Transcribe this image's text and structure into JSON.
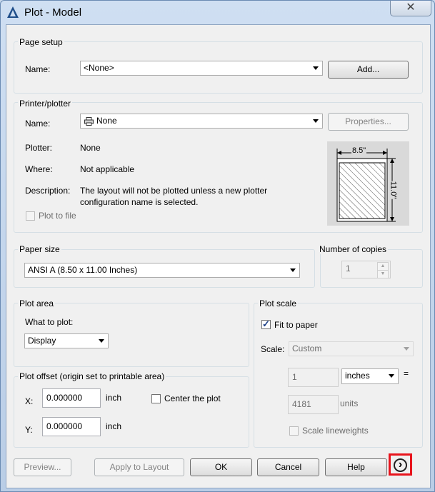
{
  "window": {
    "title": "Plot - Model",
    "close_glyph": "✕"
  },
  "page_setup": {
    "title": "Page setup",
    "name_label": "Name:",
    "name_value": "<None>",
    "add_button": "Add..."
  },
  "printer": {
    "title": "Printer/plotter",
    "name_label": "Name:",
    "name_value": "None",
    "properties_button": "Properties...",
    "plotter_label": "Plotter:",
    "plotter_value": "None",
    "where_label": "Where:",
    "where_value": "Not applicable",
    "description_label": "Description:",
    "description_line1": "The layout will not be plotted unless a new plotter",
    "description_line2": "configuration name is selected.",
    "plot_to_file_label": "Plot to file",
    "preview_width": "8.5\"",
    "preview_height": "11.0\""
  },
  "paper_size": {
    "title": "Paper size",
    "value": "ANSI A (8.50 x 11.00 Inches)"
  },
  "copies": {
    "title": "Number of copies",
    "value": "1"
  },
  "plot_area": {
    "title": "Plot area",
    "what_label": "What to plot:",
    "what_value": "Display"
  },
  "plot_scale": {
    "title": "Plot scale",
    "fit_to_paper_label": "Fit to paper",
    "fit_to_paper_checked": true,
    "scale_label": "Scale:",
    "scale_value": "Custom",
    "value1": "1",
    "unit1": "inches",
    "equals": "=",
    "value2": "4181",
    "unit2": "units",
    "lineweights_label": "Scale lineweights"
  },
  "plot_offset": {
    "title": "Plot offset (origin set to printable area)",
    "x_label": "X:",
    "x_value": "0.000000",
    "x_unit": "inch",
    "y_label": "Y:",
    "y_value": "0.000000",
    "y_unit": "inch",
    "center_label": "Center the plot"
  },
  "footer": {
    "preview": "Preview...",
    "apply": "Apply to Layout",
    "ok": "OK",
    "cancel": "Cancel",
    "help": "Help",
    "more_glyph": "›"
  },
  "colors": {
    "highlight": "#e8141c",
    "check": "#1c3f87"
  }
}
